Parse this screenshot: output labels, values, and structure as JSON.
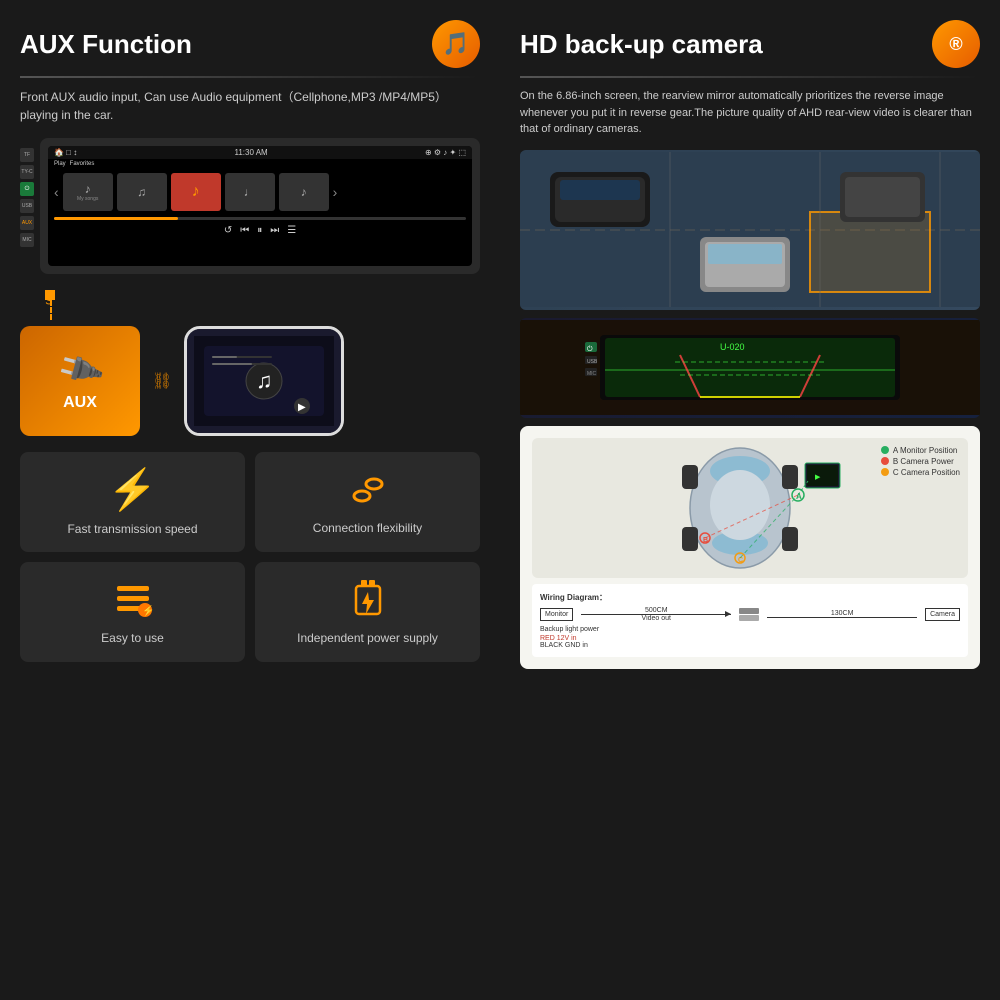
{
  "left": {
    "title": "AUX Function",
    "icon": "🎵",
    "description": "Front AUX audio input, Can use Audio equipment（Cellphone,MP3\n/MP4/MP5）playing in the car.",
    "stereo": {
      "time": "11:30 AM",
      "status_icons": "WiFi BT"
    },
    "aux_label": "AUX",
    "features": [
      {
        "id": "fast-transmission",
        "icon": "⚡",
        "label": "Fast transmission speed",
        "icon_color": "#ff9800"
      },
      {
        "id": "connection-flexibility",
        "icon": "🔗",
        "label": "Connection flexibility",
        "icon_color": "#ff9800"
      },
      {
        "id": "easy-to-use",
        "icon": "≡",
        "label": "Easy to use",
        "icon_color": "#ff9800"
      },
      {
        "id": "independent-power",
        "icon": "🔌",
        "label": "Independent power supply",
        "icon_color": "#ff9800"
      }
    ]
  },
  "right": {
    "title": "HD back-up camera",
    "icon": "®",
    "description": "On the 6.86-inch screen, the rearview mirror automatically prioritizes the reverse image whenever you put it in reverse gear.The picture quality of AHD rear-view video is clearer than that of ordinary cameras.",
    "diagram": {
      "title": "Wiring Diagram：",
      "cable_length_1": "500CM",
      "cable_length_2": "130CM",
      "labels": {
        "monitor_label": "Monitor",
        "video_out": "Video out",
        "backup_light": "Backup light power",
        "red": "RED   12V in",
        "black": "BLACK GND in",
        "camera_label": "Camera"
      },
      "legend": [
        {
          "color": "green",
          "label": "A   Monitor Position"
        },
        {
          "color": "red",
          "label": "B   Camera Power"
        },
        {
          "color": "orange",
          "label": "C   Camera Position"
        }
      ]
    }
  }
}
